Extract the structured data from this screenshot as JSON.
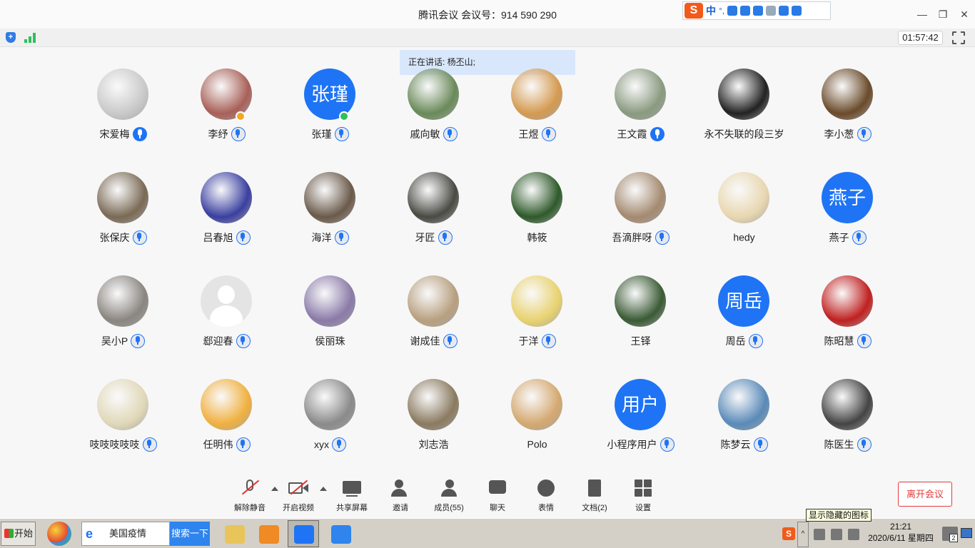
{
  "window": {
    "title": "腾讯会议 会议号：914 590 290"
  },
  "infobar": {
    "timer": "01:57:42"
  },
  "speaking": {
    "text": "正在讲话: 杨丕山;"
  },
  "participants": [
    {
      "name": "宋爱梅",
      "avatar": "photo",
      "color": "#c9c9c9",
      "mic": "active"
    },
    {
      "name": "李纾",
      "avatar": "photo",
      "color": "#a86058",
      "mic": "muted",
      "badge": "host"
    },
    {
      "name": "张瑾",
      "avatar": "text",
      "initials": "张瑾",
      "mic": "muted",
      "badge": "cohost"
    },
    {
      "name": "戚向敏",
      "avatar": "photo",
      "color": "#6a8a5a",
      "mic": "muted"
    },
    {
      "name": "王煜",
      "avatar": "photo",
      "color": "#d49a50",
      "mic": "muted"
    },
    {
      "name": "王文霞",
      "avatar": "photo",
      "color": "#8a9a80",
      "mic": "active"
    },
    {
      "name": "永不失联的段三岁",
      "avatar": "photo",
      "color": "#222222",
      "mic": "none"
    },
    {
      "name": "李小葱",
      "avatar": "photo",
      "color": "#6a4a2a",
      "mic": "muted"
    },
    {
      "name": "张保庆",
      "avatar": "photo",
      "color": "#7a6a55",
      "mic": "muted"
    },
    {
      "name": "吕春旭",
      "avatar": "photo",
      "color": "#3a3fa0",
      "mic": "muted"
    },
    {
      "name": "海洋",
      "avatar": "photo",
      "color": "#6a5a4a",
      "mic": "muted"
    },
    {
      "name": "牙匠",
      "avatar": "photo",
      "color": "#4a4a44",
      "mic": "muted"
    },
    {
      "name": "韩筱",
      "avatar": "photo",
      "color": "#2e5a2a",
      "mic": "none"
    },
    {
      "name": "吾滴胖呀",
      "avatar": "photo",
      "color": "#a48a70",
      "mic": "muted"
    },
    {
      "name": "hedy",
      "avatar": "photo",
      "color": "#e8d7b0",
      "mic": "none"
    },
    {
      "name": "燕子",
      "avatar": "text",
      "initials": "燕子",
      "mic": "muted"
    },
    {
      "name": "吴小P",
      "avatar": "photo",
      "color": "#8a8580",
      "mic": "muted"
    },
    {
      "name": "郄迎春",
      "avatar": "default",
      "mic": "muted"
    },
    {
      "name": "侯丽珠",
      "avatar": "photo",
      "color": "#8a7aa8",
      "mic": "none"
    },
    {
      "name": "谢成佳",
      "avatar": "photo",
      "color": "#b8a080",
      "mic": "muted"
    },
    {
      "name": "于洋",
      "avatar": "photo",
      "color": "#e8d270",
      "mic": "muted"
    },
    {
      "name": "王铎",
      "avatar": "photo",
      "color": "#3a5a34",
      "mic": "none"
    },
    {
      "name": "周岳",
      "avatar": "text",
      "initials": "周岳",
      "mic": "muted"
    },
    {
      "name": "陈昭慧",
      "avatar": "photo",
      "color": "#c02020",
      "mic": "muted"
    },
    {
      "name": "吱吱吱吱吱",
      "avatar": "photo",
      "color": "#e0d8b8",
      "mic": "muted"
    },
    {
      "name": "任明伟",
      "avatar": "photo",
      "color": "#f0b040",
      "mic": "muted"
    },
    {
      "name": "xyx",
      "avatar": "photo",
      "color": "#8a8a8a",
      "mic": "muted"
    },
    {
      "name": "刘志浩",
      "avatar": "photo",
      "color": "#8a7a60",
      "mic": "none"
    },
    {
      "name": "Polo",
      "avatar": "photo",
      "color": "#d4a870",
      "mic": "none"
    },
    {
      "name": "小程序用户",
      "avatar": "text",
      "initials": "用户",
      "mic": "muted"
    },
    {
      "name": "陈梦云",
      "avatar": "photo",
      "color": "#5a8ab8",
      "mic": "muted"
    },
    {
      "name": "陈医生",
      "avatar": "photo",
      "color": "#444444",
      "mic": "muted"
    }
  ],
  "toolbar": {
    "unmute": "解除静音",
    "video": "开启视频",
    "share": "共享屏幕",
    "invite": "邀请",
    "members": "成员(55)",
    "chat": "聊天",
    "emoji": "表情",
    "docs": "文档(2)",
    "settings": "设置",
    "leave": "离开会议"
  },
  "tooltip": "显示隐藏的图标",
  "taskbar": {
    "start": "开始",
    "search_value": "美国疫情",
    "search_button": "搜索一下",
    "time": "21:21",
    "date": "2020/6/11 星期四",
    "notif_count": "2"
  },
  "ime": {
    "mode": "中"
  },
  "colors": {
    "accent": "#1e74f5",
    "danger": "#e33b3b",
    "host_badge": "#f5a623",
    "cohost_badge": "#2ec05c"
  }
}
